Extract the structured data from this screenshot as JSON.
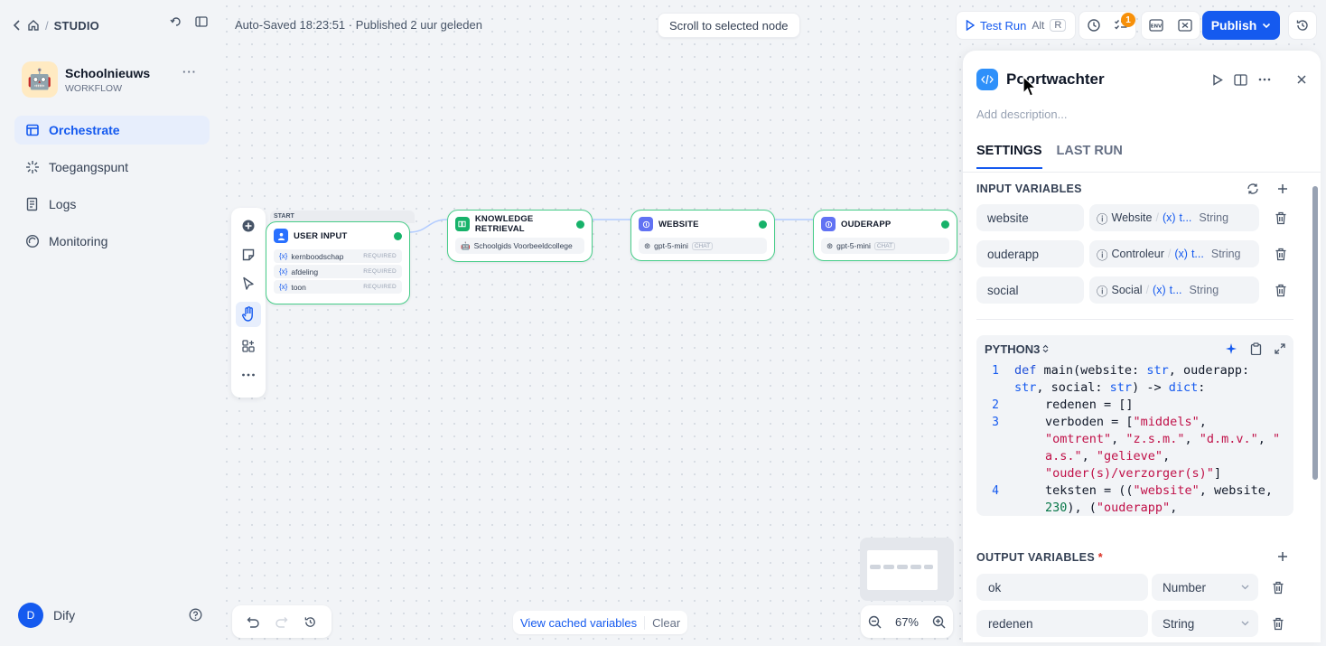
{
  "sidebar": {
    "studio_label": "STUDIO",
    "slash": "/",
    "app": {
      "emoji": "🤖",
      "name": "Schoolnieuws",
      "type": "WORKFLOW",
      "more": "···"
    },
    "nav": [
      {
        "label": "Orchestrate"
      },
      {
        "label": "Toegangspunt"
      },
      {
        "label": "Logs"
      },
      {
        "label": "Monitoring"
      }
    ],
    "user": {
      "initial": "D",
      "name": "Dify"
    }
  },
  "header": {
    "autosave": "Auto-Saved 18:23:51 · Published 2 uur geleden",
    "scroll_btn": "Scroll to selected node",
    "test_run": "Test Run",
    "test_run_kbd_alt": "Alt",
    "test_run_kbd_r": "R",
    "checklist_badge": "1",
    "publish": "Publish"
  },
  "nodes": {
    "start_tag": "START",
    "user_input": {
      "title": "USER INPUT",
      "vars": [
        {
          "name": "kernboodschap",
          "req": "REQUIRED"
        },
        {
          "name": "afdeling",
          "req": "REQUIRED"
        },
        {
          "name": "toon",
          "req": "REQUIRED"
        }
      ]
    },
    "knowledge": {
      "title": "KNOWLEDGE RETRIEVAL",
      "sub": "Schoolgids Voorbeeldcollege"
    },
    "website": {
      "title": "WEBSITE",
      "model": "gpt-5-mini",
      "tag": "CHAT"
    },
    "ouderapp": {
      "title": "OUDERAPP",
      "model": "gpt-5-mini",
      "tag": "CHAT"
    }
  },
  "bottom": {
    "view_cached": "View cached variables",
    "clear": "Clear",
    "zoom": "67%"
  },
  "panel": {
    "title": "Poortwachter",
    "description_placeholder": "Add description...",
    "tabs": [
      {
        "label": "SETTINGS"
      },
      {
        "label": "LAST RUN"
      }
    ],
    "input_title": "INPUT VARIABLES",
    "inputs": [
      {
        "name": "website",
        "node": "Website",
        "var": "t...",
        "type": "String"
      },
      {
        "name": "ouderapp",
        "node": "Controleur",
        "var": "t...",
        "type": "String"
      },
      {
        "name": "social",
        "node": "Social",
        "var": "t...",
        "type": "String"
      }
    ],
    "code_lang": "PYTHON3",
    "output_title": "OUTPUT VARIABLES",
    "output_required": "*",
    "outputs": [
      {
        "name": "ok",
        "type": "Number"
      },
      {
        "name": "redenen",
        "type": "String"
      }
    ]
  },
  "colors": {
    "accent": "#155aef",
    "success": "#17b26a",
    "node_border": "#47cd89",
    "badge": "#f79009"
  }
}
